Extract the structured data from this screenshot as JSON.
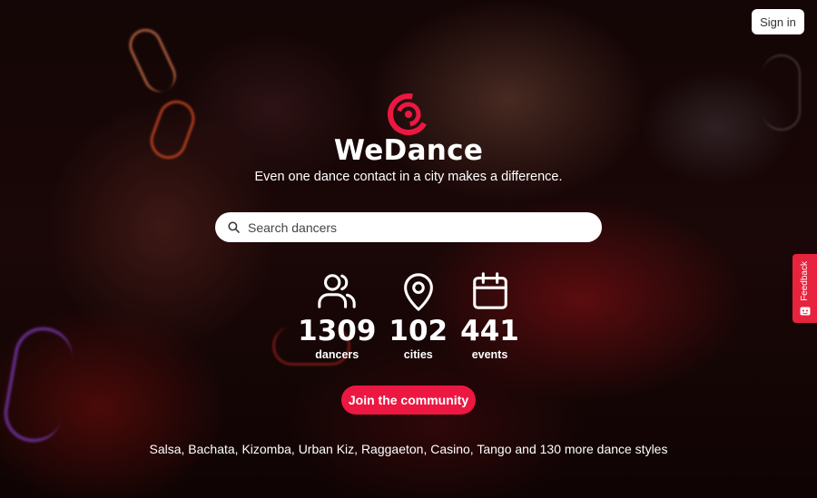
{
  "header": {
    "signin_label": "Sign in"
  },
  "brand": {
    "name": "WeDance",
    "tagline": "Even one dance contact in a city makes a difference."
  },
  "search": {
    "placeholder": "Search dancers",
    "value": ""
  },
  "stats": [
    {
      "icon": "users-icon",
      "value": "1309",
      "label": "dancers"
    },
    {
      "icon": "map-pin-icon",
      "value": "102",
      "label": "cities"
    },
    {
      "icon": "calendar-icon",
      "value": "441",
      "label": "events"
    }
  ],
  "cta": {
    "join_label": "Join the community"
  },
  "footer": {
    "styles_text": "Salsa, Bachata, Kizomba, Urban Kiz, Raggaeton, Casino, Tango and 130 more dance styles"
  },
  "feedback": {
    "label": "Feedback",
    "icon": "feedback-icon"
  },
  "colors": {
    "accent": "#ec1841",
    "feedback_tab": "#e8233e",
    "text": "#ffffff"
  }
}
